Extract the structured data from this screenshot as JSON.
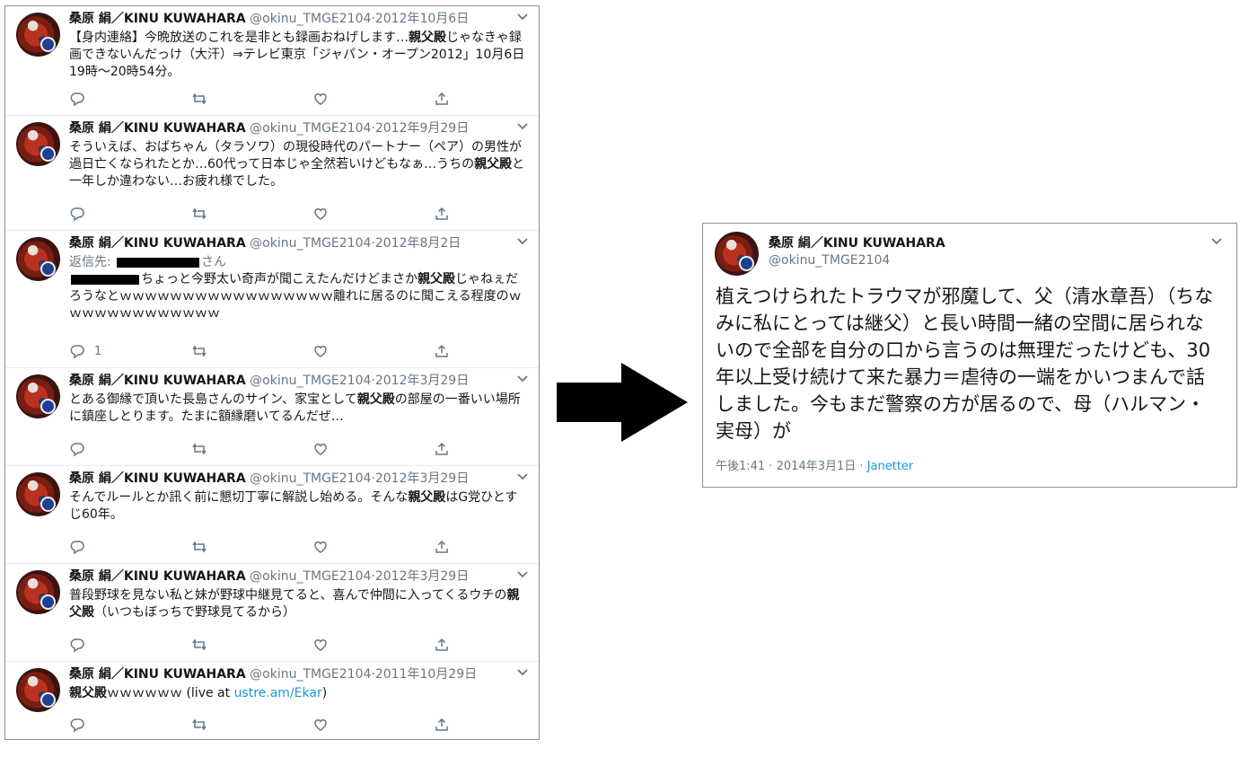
{
  "left_timeline": {
    "tweets": [
      {
        "name": "桑原 絹／KINU KUWAHARA",
        "handle": "@okinu_TMGE2104",
        "date": "2012年10月6日",
        "body_parts": [
          {
            "t": "【身内連絡】今晩放送のこれを是非とも録画おねげします…",
            "b": false
          },
          {
            "t": "親父殿",
            "b": true
          },
          {
            "t": "じゃなきゃ録画できないんだっけ（大汗）⇒テレビ東京「ジャパン・オープン2012」10月6日19時～20時54分。",
            "b": false
          }
        ],
        "reply_count": ""
      },
      {
        "name": "桑原 絹／KINU KUWAHARA",
        "handle": "@okinu_TMGE2104",
        "date": "2012年9月29日",
        "body_parts": [
          {
            "t": "そういえば、おばちゃん（タラソワ）の現役時代のパートナー（ペア）の男性が過日亡くなられたとか…60代って日本じゃ全然若いけどもなぁ…うちの",
            "b": false
          },
          {
            "t": "親父殿",
            "b": true
          },
          {
            "t": "と一年しか違わない…お疲れ様でした。",
            "b": false
          }
        ],
        "reply_count": ""
      },
      {
        "name": "桑原 絹／KINU KUWAHARA",
        "handle": "@okinu_TMGE2104",
        "date": "2012年8月2日",
        "reply_prefix": "返信先:",
        "reply_suffix": "さん",
        "body_parts": [
          {
            "t": "ちょっと今野太い奇声が聞こえたんだけどまさか",
            "b": false
          },
          {
            "t": "親父殿",
            "b": true
          },
          {
            "t": "じゃねぇだろうなとｗｗｗｗｗｗｗｗｗｗｗｗｗｗｗｗｗ離れに居るのに聞こえる程度のｗｗｗｗｗｗｗｗｗｗｗｗｗ",
            "b": false
          }
        ],
        "reply_count": "1"
      },
      {
        "name": "桑原 絹／KINU KUWAHARA",
        "handle": "@okinu_TMGE2104",
        "date": "2012年3月29日",
        "body_parts": [
          {
            "t": "とある御縁で頂いた長島さんのサイン、家宝として",
            "b": false
          },
          {
            "t": "親父殿",
            "b": true
          },
          {
            "t": "の部屋の一番いい場所に鎮座しとります。たまに額縁磨いてるんだぜ…",
            "b": false
          }
        ],
        "reply_count": ""
      },
      {
        "name": "桑原 絹／KINU KUWAHARA",
        "handle": "@okinu_TMGE2104",
        "date": "2012年3月29日",
        "body_parts": [
          {
            "t": "そんでルールとか訊く前に懇切丁寧に解説し始める。そんな",
            "b": false
          },
          {
            "t": "親父殿",
            "b": true
          },
          {
            "t": "はG党ひとすじ60年。",
            "b": false
          }
        ],
        "reply_count": ""
      },
      {
        "name": "桑原 絹／KINU KUWAHARA",
        "handle": "@okinu_TMGE2104",
        "date": "2012年3月29日",
        "body_parts": [
          {
            "t": "普段野球を見ない私と妹が野球中継見てると、喜んで仲間に入ってくるウチの",
            "b": false
          },
          {
            "t": "親父殿",
            "b": true
          },
          {
            "t": "（いつもぼっちで野球見てるから）",
            "b": false
          }
        ],
        "reply_count": ""
      },
      {
        "name": "桑原 絹／KINU KUWAHARA",
        "handle": "@okinu_TMGE2104",
        "date": "2011年10月29日",
        "body_parts": [
          {
            "t": "親父殿",
            "b": true
          },
          {
            "t": "ｗｗｗｗｗｗ (live at ",
            "b": false
          },
          {
            "t": "ustre.am/Ekar",
            "b": false,
            "link": true
          },
          {
            "t": ")",
            "b": false
          }
        ],
        "reply_count": ""
      }
    ]
  },
  "right_card": {
    "name": "桑原 絹／KINU KUWAHARA",
    "handle": "@okinu_TMGE2104",
    "text": "植えつけられたトラウマが邪魔して、父（清水章吾）（ちなみに私にとっては継父）と長い時間一緒の空間に居られないので全部を自分の口から言うのは無理だったけども、30年以上受け続けて来た暴力＝虐待の一端をかいつまんで話しました。今もまだ警察の方が居るので、母（ハルマン・実母）が",
    "time": "午後1:41",
    "date": "2014年3月1日",
    "separator": "·",
    "app": "Janetter"
  },
  "icons": [
    "reply-icon",
    "retweet-icon",
    "like-icon",
    "share-icon",
    "chevron-down-icon",
    "arrow-right-icon",
    "avatar"
  ],
  "colors": {
    "name": "#14171a",
    "muted": "#657786",
    "link": "#1b95e0",
    "border": "#8f8f8f"
  }
}
